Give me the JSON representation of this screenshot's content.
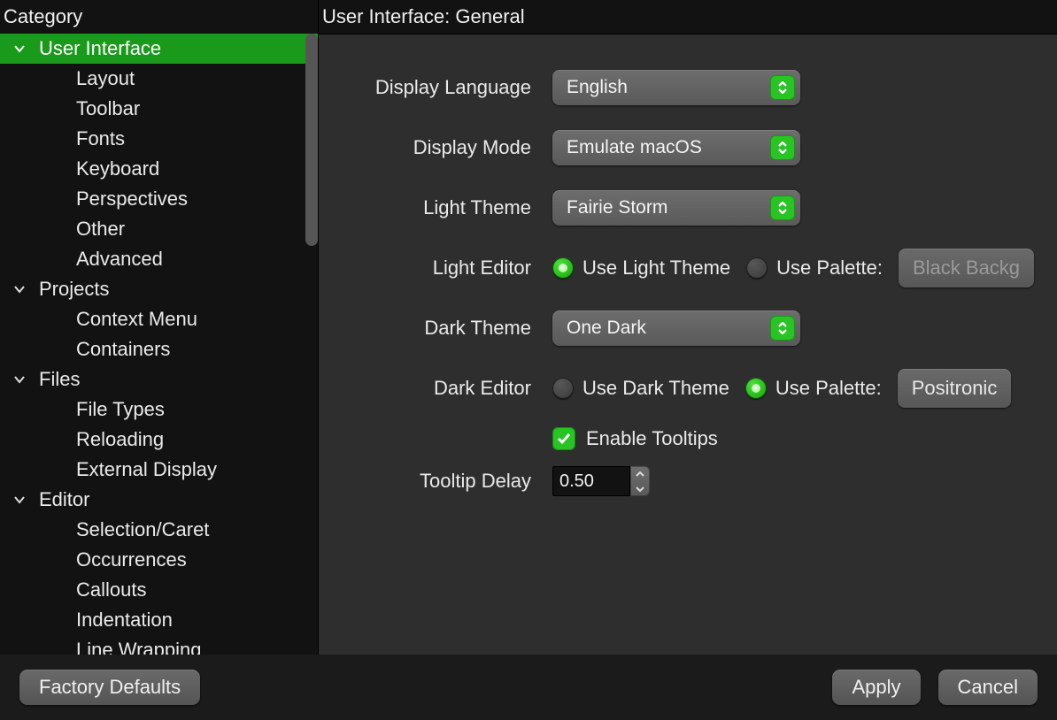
{
  "sidebar": {
    "header": "Category",
    "groups": [
      {
        "label": "User Interface",
        "selected": true,
        "items": [
          "Layout",
          "Toolbar",
          "Fonts",
          "Keyboard",
          "Perspectives",
          "Other",
          "Advanced"
        ]
      },
      {
        "label": "Projects",
        "items": [
          "Context Menu",
          "Containers"
        ]
      },
      {
        "label": "Files",
        "items": [
          "File Types",
          "Reloading",
          "External Display"
        ]
      },
      {
        "label": "Editor",
        "items": [
          "Selection/Caret",
          "Occurrences",
          "Callouts",
          "Indentation",
          "Line Wrapping"
        ]
      }
    ]
  },
  "content": {
    "title": "User Interface: General",
    "rows": {
      "display_language": {
        "label": "Display Language",
        "value": "English"
      },
      "display_mode": {
        "label": "Display Mode",
        "value": "Emulate macOS"
      },
      "light_theme": {
        "label": "Light Theme",
        "value": "Fairie Storm"
      },
      "light_editor": {
        "label": "Light Editor",
        "opt_theme": "Use Light Theme",
        "opt_palette": "Use Palette:",
        "palette_value": "Black Backg",
        "selected": "theme"
      },
      "dark_theme": {
        "label": "Dark Theme",
        "value": "One Dark"
      },
      "dark_editor": {
        "label": "Dark Editor",
        "opt_theme": "Use Dark Theme",
        "opt_palette": "Use Palette:",
        "palette_value": "Positronic",
        "selected": "palette"
      },
      "enable_tooltips": {
        "label": "Enable Tooltips",
        "checked": true
      },
      "tooltip_delay": {
        "label": "Tooltip Delay",
        "value": "0.50"
      }
    }
  },
  "footer": {
    "factory_defaults": "Factory Defaults",
    "apply": "Apply",
    "cancel": "Cancel"
  }
}
